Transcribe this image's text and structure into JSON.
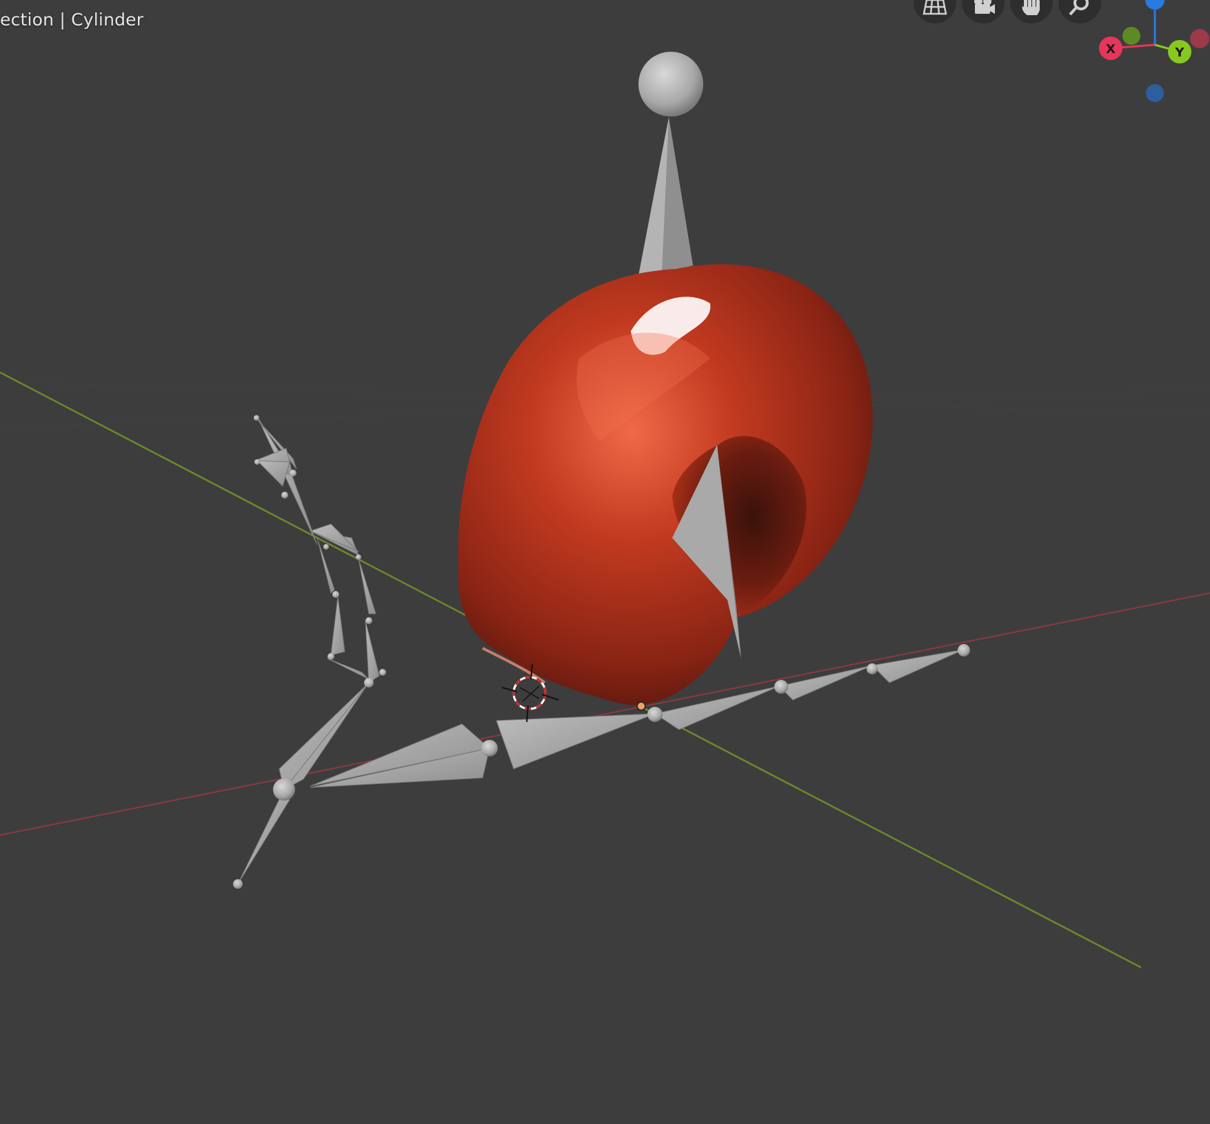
{
  "viewport": {
    "header_text": "ection | Cylinder",
    "background_color": "#3d3d3d"
  },
  "navigation": {
    "buttons": [
      {
        "name": "toggle-ortho",
        "icon": "grid-icon"
      },
      {
        "name": "camera-view",
        "icon": "camera-icon"
      },
      {
        "name": "pan-view",
        "icon": "hand-icon"
      },
      {
        "name": "zoom-view",
        "icon": "magnifier-icon"
      }
    ]
  },
  "gizmo": {
    "x_label": "X",
    "y_label": "Y",
    "x_color": "#e8365a",
    "y_color": "#87c820",
    "z_color": "#2a7ae0"
  },
  "scene": {
    "x_axis_color": "#8a3a42",
    "y_axis_color": "#6b8a2a",
    "mesh_color": "#b0321c",
    "bone_color": "#a5a5a5"
  }
}
